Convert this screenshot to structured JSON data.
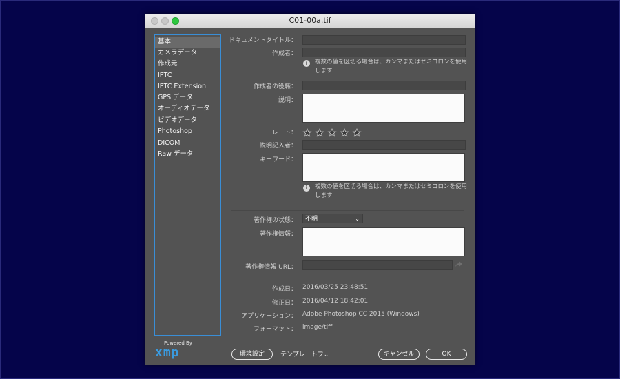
{
  "window": {
    "title": "C01-00a.tif"
  },
  "sidebar": {
    "items": [
      {
        "label": "基本"
      },
      {
        "label": "カメラデータ"
      },
      {
        "label": "作成元"
      },
      {
        "label": "IPTC"
      },
      {
        "label": "IPTC Extension"
      },
      {
        "label": "GPS データ"
      },
      {
        "label": "オーディオデータ"
      },
      {
        "label": "ビデオデータ"
      },
      {
        "label": "Photoshop"
      },
      {
        "label": "DICOM"
      },
      {
        "label": "Raw データ"
      }
    ],
    "selected_index": 0
  },
  "branding": {
    "powered_by": "Powered By",
    "logo": "xmp"
  },
  "form": {
    "document_title_label": "ドキュメントタイトル：",
    "author_label": "作成者：",
    "author_hint": "複数の値を区切る場合は、カンマまたはセミコロンを使用します",
    "author_title_label": "作成者の役職：",
    "description_label": "説明：",
    "rating_label": "レート：",
    "rating_value": 0,
    "rating_max": 5,
    "description_writer_label": "説明記入者：",
    "keywords_label": "キーワード：",
    "keywords_hint": "複数の値を区切る場合は、カンマまたはセミコロンを使用します",
    "copyright_status_label": "著作権の状態：",
    "copyright_status_value": "不明",
    "copyright_notice_label": "著作権情報：",
    "copyright_url_label": "著作権情報 URL："
  },
  "info": {
    "created_label": "作成日：",
    "created_value": "2016/03/25 23:48:51",
    "modified_label": "修正日：",
    "modified_value": "2016/04/12 18:42:01",
    "application_label": "アプリケーション：",
    "application_value": "Adobe Photoshop CC 2015 (Windows)",
    "format_label": "フォーマット：",
    "format_value": "image/tiff"
  },
  "footer": {
    "preferences_label": "環境設定",
    "template_label": "テンプレートフ",
    "cancel_label": "キャンセル",
    "ok_label": "OK"
  },
  "colors": {
    "accent": "#3a8ed6",
    "background": "#05044a",
    "panel": "#535353"
  }
}
